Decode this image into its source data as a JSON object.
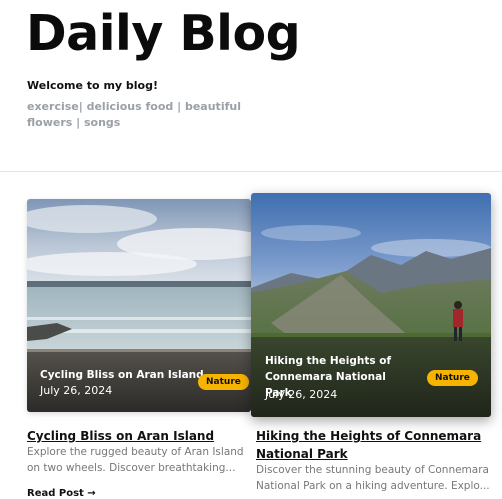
{
  "header": {
    "title": "Daily Blog",
    "welcome": "Welcome to my blog!",
    "tags": "exercise| delicious food | beautiful flowers | songs"
  },
  "posts": [
    {
      "title": "Cycling Bliss on Aran Island",
      "date": "July 26, 2024",
      "tag": "Nature",
      "excerpt": "Explore the rugged beauty of Aran Island on two wheels. Discover breathtaking...",
      "read_more": "Read Post →"
    },
    {
      "title": "Hiking the Heights of Connemara National Park",
      "date": "July 26, 2024",
      "tag": "Nature",
      "excerpt": "Discover the stunning beauty of Connemara National Park on a hiking adventure. Explo..."
    }
  ],
  "colors": {
    "badge": "#f6b400",
    "muted_text": "#9aa0a8",
    "divider": "#f3e3c8"
  }
}
